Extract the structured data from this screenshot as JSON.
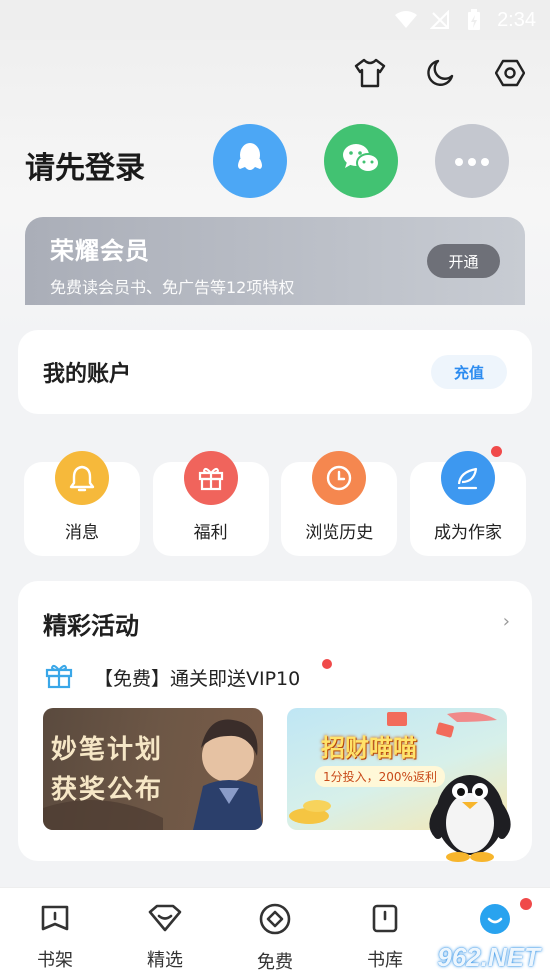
{
  "status_bar": {
    "time": "2:34"
  },
  "header": {
    "icons": [
      "tshirt-icon",
      "moon-icon",
      "settings-icon"
    ]
  },
  "login": {
    "title": "请先登录",
    "options": [
      "qq-icon",
      "wechat-icon",
      "more-icon"
    ]
  },
  "vip": {
    "title": "荣耀会员",
    "subtitle": "免费读会员书、免广告等12项特权",
    "button": "开通"
  },
  "account": {
    "title": "我的账户",
    "button": "充值"
  },
  "quick_actions": [
    {
      "label": "消息",
      "icon": "bell-icon",
      "color": "#f6b93b"
    },
    {
      "label": "福利",
      "icon": "gift-icon",
      "color": "#f0645c"
    },
    {
      "label": "浏览历史",
      "icon": "clock-icon",
      "color": "#f5874f"
    },
    {
      "label": "成为作家",
      "icon": "pen-icon",
      "color": "#3d98f0",
      "badge": true
    }
  ],
  "activities": {
    "title": "精彩活动",
    "promo_text": "【免费】通关即送VIP10",
    "banners": [
      {
        "text": "妙笔计划 获奖公布"
      },
      {
        "title": "招财喵喵",
        "subtitle": "1分投入，200%返利"
      }
    ]
  },
  "bottom_nav": [
    {
      "label": "书架",
      "icon": "bookshelf-icon"
    },
    {
      "label": "精选",
      "icon": "featured-icon"
    },
    {
      "label": "免费",
      "icon": "free-icon"
    },
    {
      "label": "书库",
      "icon": "library-icon"
    },
    {
      "label": "",
      "icon": "profile-icon"
    }
  ],
  "watermark": "962.NET"
}
